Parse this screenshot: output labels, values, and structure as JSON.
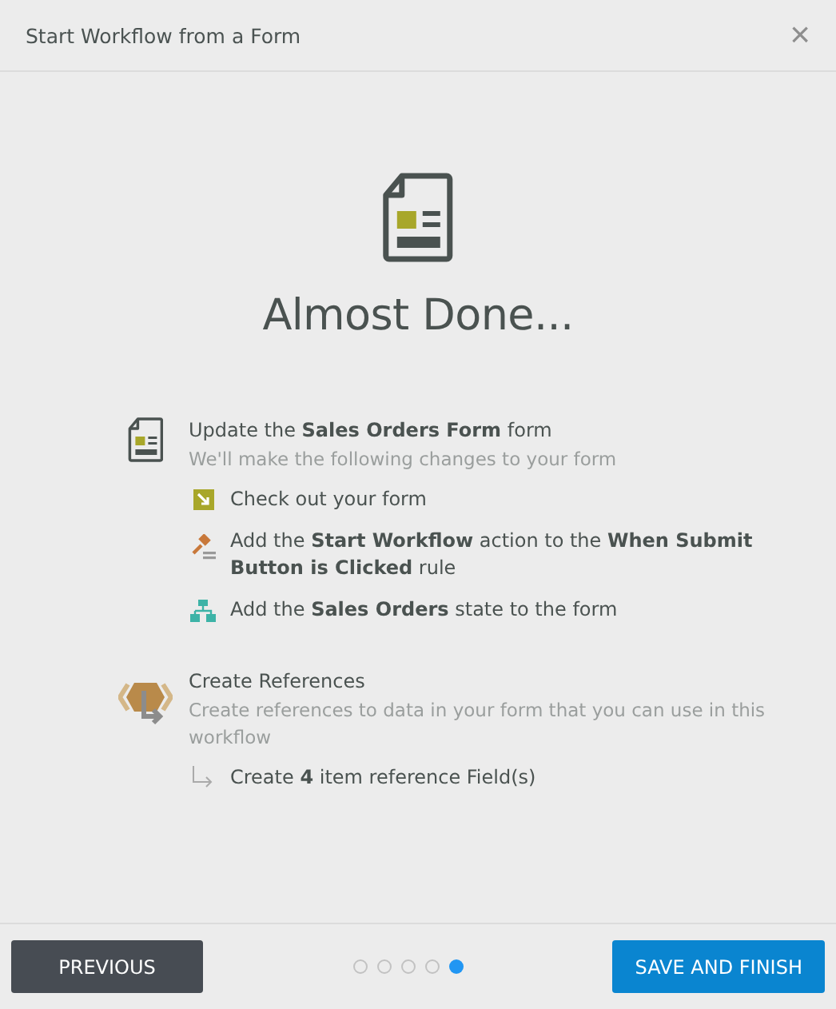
{
  "window": {
    "title": "Start Workflow from a Form",
    "close": "×"
  },
  "heading": "Almost Done...",
  "sections": [
    {
      "kind": "form",
      "title": "Update the **Sales Orders Form** form",
      "subtitle": "We'll make the following changes to your form",
      "items": [
        {
          "kind": "checkout",
          "text": "Check out your form"
        },
        {
          "kind": "rule",
          "text": "Add the **Start Workflow** action to the **When Submit Button is Clicked** rule"
        },
        {
          "kind": "state",
          "text": "Add the **Sales Orders** state to the form"
        }
      ]
    },
    {
      "kind": "references",
      "title": "Create References",
      "subtitle": "Create references to data in your form that you can use in this workflow",
      "items": [
        {
          "kind": "sub",
          "text": "Create **4** item reference Field(s)"
        }
      ]
    }
  ],
  "footer": {
    "previous": "PREVIOUS",
    "finish": "SAVE AND FINISH",
    "pages": [
      {
        "selected": false
      },
      {
        "selected": false
      },
      {
        "selected": false
      },
      {
        "selected": false
      },
      {
        "selected": true
      }
    ]
  }
}
